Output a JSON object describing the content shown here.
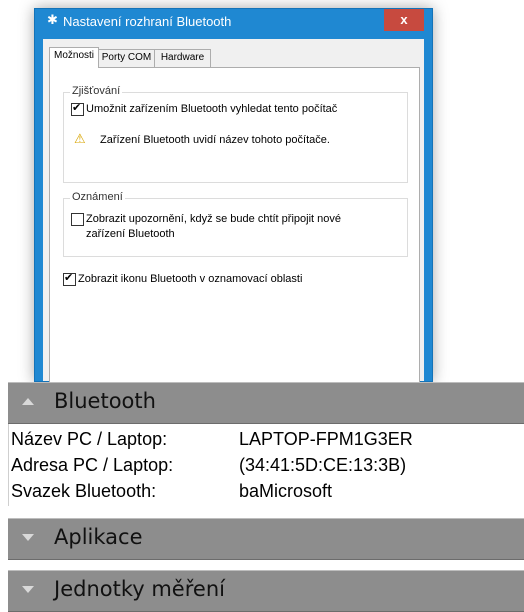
{
  "dialog": {
    "title": "Nastavení rozhraní Bluetooth",
    "close_label": "x",
    "tabs": [
      {
        "label": "Možnosti"
      },
      {
        "label": "Porty COM"
      },
      {
        "label": "Hardware"
      }
    ],
    "discovery_group": {
      "label": "Zjišťování",
      "allow_discovery": {
        "label": "Umožnit zařízením Bluetooth vyhledat tento počítač",
        "checked": true
      },
      "warning_text": "Zařízení Bluetooth uvidí název tohoto počítače."
    },
    "notifications_group": {
      "label": "Oznámení",
      "alert_new_device": {
        "label_line1": "Zobrazit upozornění, když se bude chtít připojit nové",
        "label_line2": "zařízení Bluetooth",
        "checked": false
      }
    },
    "show_icon": {
      "label": "Zobrazit ikonu Bluetooth v oznamovací oblasti",
      "checked": true
    }
  },
  "panel": {
    "bluetooth_header": "Bluetooth",
    "rows": [
      {
        "key": "Název PC / Laptop:",
        "value": "LAPTOP-FPM1G3ER"
      },
      {
        "key": "Adresa PC / Laptop:",
        "value": "(34:41:5D:CE:13:3B)"
      },
      {
        "key": "Svazek Bluetooth:",
        "value": "baMicrosoft"
      }
    ],
    "apps_header": "Aplikace",
    "units_header": "Jednotky měření"
  },
  "colors": {
    "titlebar": "#1f88d2",
    "close_button": "#c74a3f",
    "panel_header": "#8d8d8d",
    "warning": "#d8a400"
  }
}
